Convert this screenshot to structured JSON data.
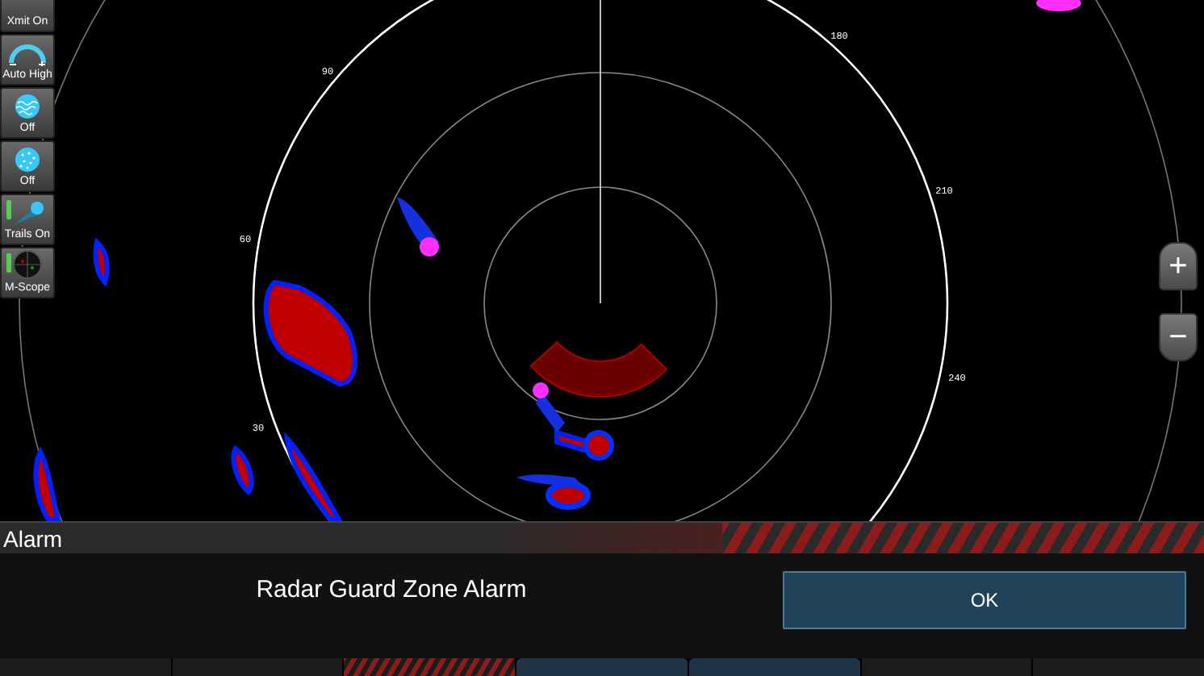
{
  "side_buttons": [
    {
      "label": "Xmit On",
      "kind": "transmit",
      "indicator_on": false
    },
    {
      "label": "Auto High",
      "kind": "gain",
      "indicator_on": false
    },
    {
      "label": "Off",
      "kind": "sea",
      "indicator_on": false
    },
    {
      "label": "Off",
      "kind": "rain",
      "indicator_on": false
    },
    {
      "label": "Trails On",
      "kind": "trails",
      "indicator_on": true
    },
    {
      "label": "M-Scope",
      "kind": "scope",
      "indicator_on": true
    }
  ],
  "bearing_labels": [
    "90",
    "60",
    "30",
    "180",
    "210",
    "240"
  ],
  "zoom_buttons": [
    "+",
    "−"
  ],
  "alarm": {
    "title": "Alarm",
    "message": "Radar Guard Zone Alarm",
    "button": "OK"
  }
}
